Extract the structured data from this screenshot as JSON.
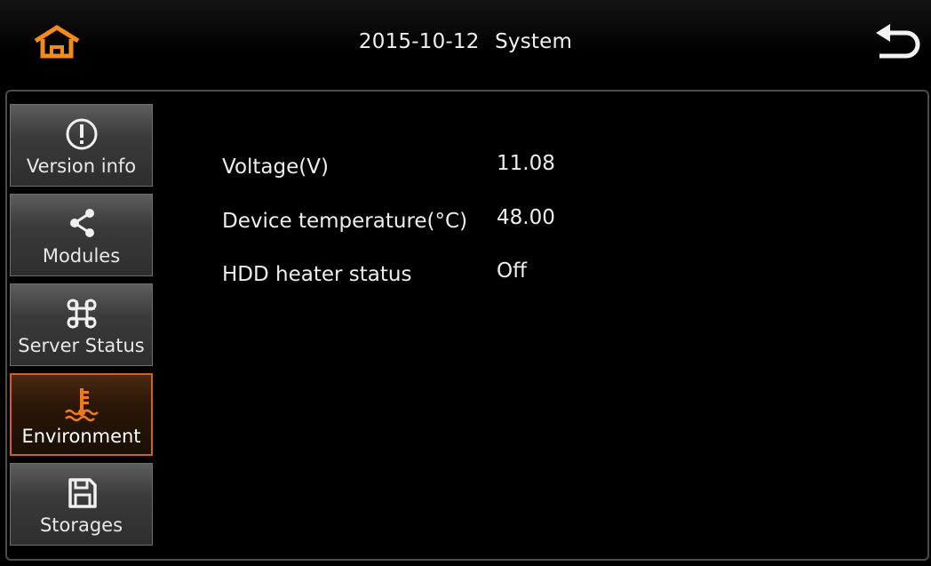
{
  "header": {
    "date": "2015-10-12",
    "title": "System"
  },
  "colors": {
    "accent": "#e8781f",
    "background": "#000000",
    "button": "#3a3a3a"
  },
  "sidebar": {
    "items": [
      {
        "label": "Version info",
        "icon": "info-icon",
        "active": false
      },
      {
        "label": "Modules",
        "icon": "share-icon",
        "active": false
      },
      {
        "label": "Server Status",
        "icon": "command-icon",
        "active": false
      },
      {
        "label": "Environment",
        "icon": "temperature-icon",
        "active": true
      },
      {
        "label": "Storages",
        "icon": "floppy-disk-icon",
        "active": false
      }
    ]
  },
  "environment": {
    "rows": [
      {
        "label": "Voltage(V)",
        "value": "11.08"
      },
      {
        "label": "Device temperature(°C)",
        "value": "48.00"
      },
      {
        "label": "HDD heater status",
        "value": "Off"
      }
    ]
  }
}
